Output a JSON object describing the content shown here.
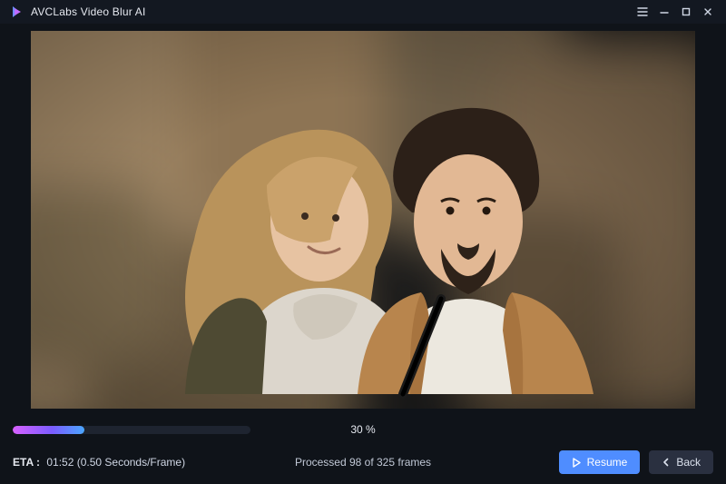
{
  "app": {
    "title": "AVCLabs Video Blur AI"
  },
  "progress": {
    "percent": 30,
    "percent_text": "30 %"
  },
  "status": {
    "eta_label": "ETA :",
    "eta_value": "01:52 (0.50 Seconds/Frame)",
    "processed_text": "Processed 98 of 325 frames"
  },
  "buttons": {
    "resume": "Resume",
    "back": "Back"
  },
  "colors": {
    "accent_gradient_start": "#d861ff",
    "accent_gradient_mid": "#7b5cff",
    "accent_gradient_end": "#4aa6ff",
    "primary_button": "#4f8dff"
  }
}
